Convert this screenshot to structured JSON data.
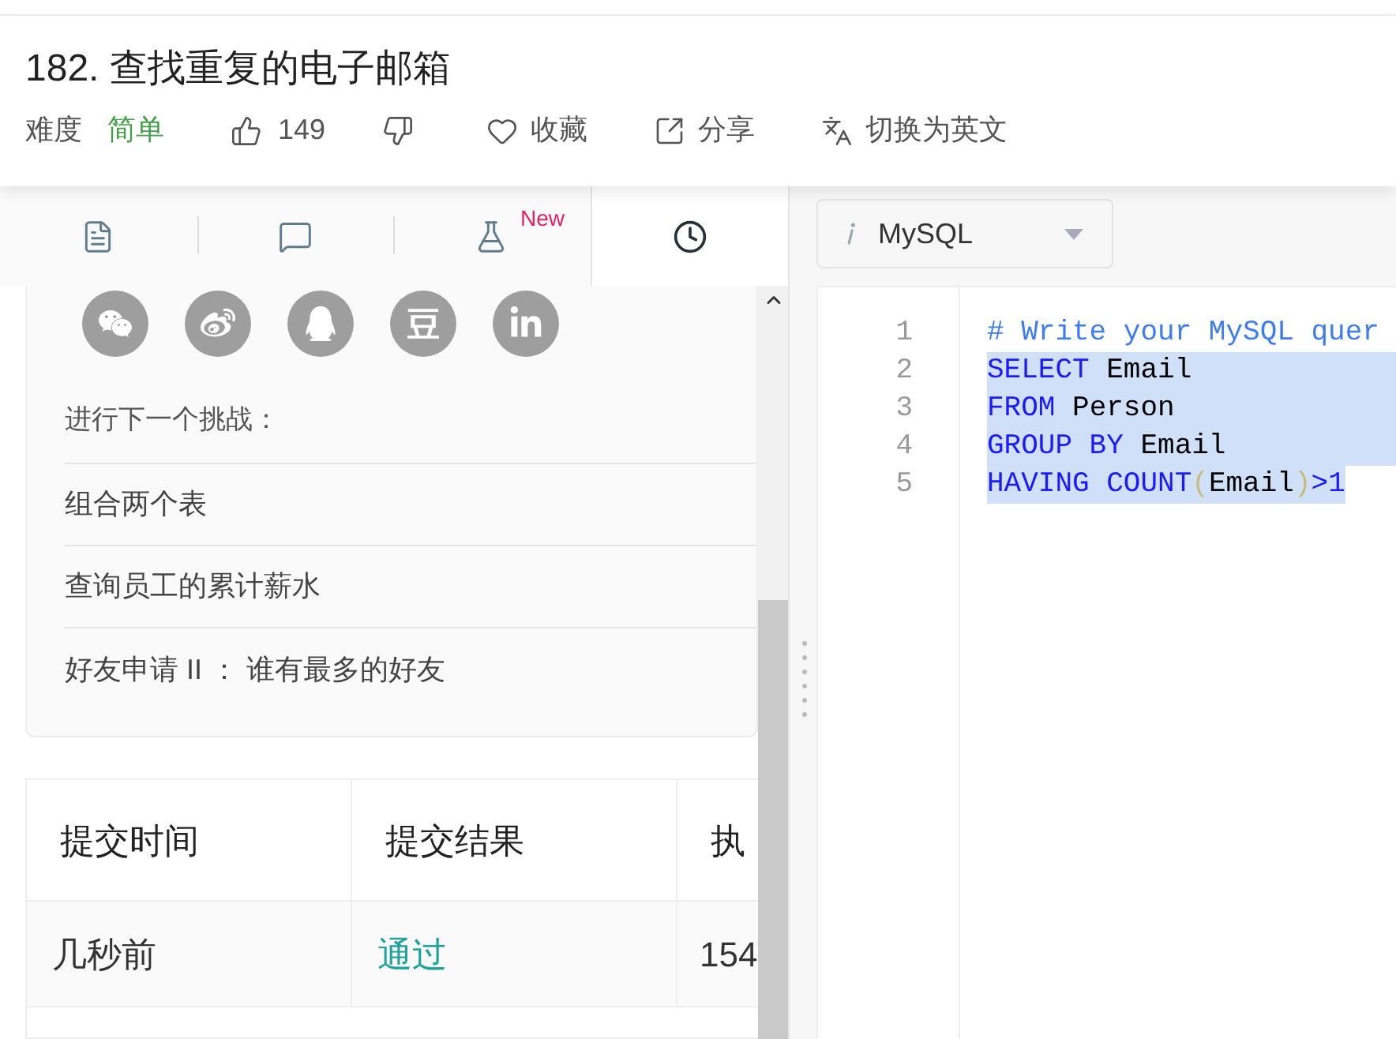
{
  "problem": {
    "title": "182. 查找重复的电子邮箱",
    "difficulty_label": "难度",
    "difficulty": "简单",
    "likes": "149",
    "actions": [
      {
        "kind": "favorite",
        "label": "收藏"
      },
      {
        "kind": "share",
        "label": "分享"
      },
      {
        "kind": "translate",
        "label": "切换为英文"
      }
    ]
  },
  "tabs": [
    {
      "kind": "description",
      "selected": false
    },
    {
      "kind": "comments",
      "selected": false
    },
    {
      "kind": "lab",
      "selected": false,
      "badge": "New"
    },
    {
      "kind": "history",
      "selected": true
    }
  ],
  "share_icons": [
    {
      "kind": "chat"
    },
    {
      "kind": "swirl"
    },
    {
      "kind": "penguin"
    },
    {
      "kind": "glyph"
    },
    {
      "kind": "letters"
    }
  ],
  "next_challenge": {
    "heading": "进行下一个挑战：",
    "items": [
      "组合两个表",
      "查询员工的累计薪水",
      "好友申请 II ： 谁有最多的好友"
    ]
  },
  "submissions": {
    "columns": [
      "提交时间",
      "提交结果",
      "执"
    ],
    "rows": [
      [
        {
          "text": "几秒前",
          "kind": "plain"
        },
        {
          "text": "通过",
          "kind": "success"
        },
        {
          "text": "154",
          "kind": "plain"
        }
      ]
    ]
  },
  "editor": {
    "language": "MySQL",
    "lines": [
      {
        "number": "1",
        "selected": false,
        "tokens": [
          {
            "kind": "comment",
            "text": "# Write your MySQL quer"
          }
        ]
      },
      {
        "number": "2",
        "selected": true,
        "tokens": [
          {
            "kind": "keyword",
            "text": "SELECT"
          },
          {
            "kind": "plain",
            "text": " Email"
          }
        ]
      },
      {
        "number": "3",
        "selected": true,
        "tokens": [
          {
            "kind": "keyword",
            "text": "FROM"
          },
          {
            "kind": "plain",
            "text": " Person"
          }
        ]
      },
      {
        "number": "4",
        "selected": true,
        "tokens": [
          {
            "kind": "keyword",
            "text": "GROUP BY"
          },
          {
            "kind": "plain",
            "text": " Email"
          }
        ]
      },
      {
        "number": "5",
        "selected": true,
        "tokens": [
          {
            "kind": "keyword",
            "text": "HAVING COUNT"
          },
          {
            "kind": "bracket",
            "text": "("
          },
          {
            "kind": "plain",
            "text": "Email"
          },
          {
            "kind": "bracket",
            "text": ")"
          },
          {
            "kind": "keyword",
            "text": ">1"
          }
        ]
      }
    ]
  }
}
